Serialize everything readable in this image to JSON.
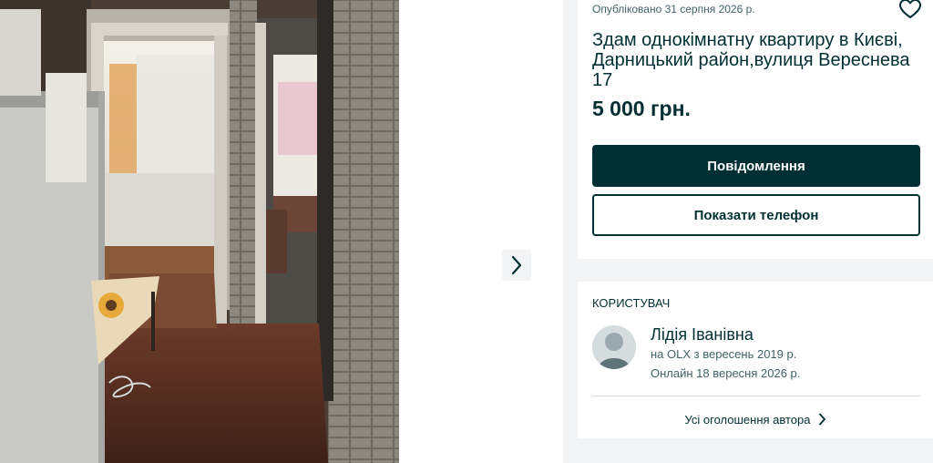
{
  "listing": {
    "published": "Опубліковано 31 серпня 2026 р.",
    "title": "Здам однокімнатну квартиру в Києві, Дарницький район,вулиця Вереснева 17",
    "price": "5 000 грн."
  },
  "actions": {
    "message_label": "Повідомлення",
    "show_phone_label": "Показати телефон"
  },
  "seller": {
    "section_label": "КОРИСТУВАЧ",
    "name": "Лідія Іванівна",
    "member_since": "на OLX з вересень 2019 р.",
    "online": "Онлайн 18 вересня 2026 р.",
    "all_ads_label": "Усі оголошення автора"
  },
  "icons": {
    "favorite": "heart-icon",
    "gallery_next": "chevron-right-icon",
    "all_ads": "chevron-right-icon"
  },
  "colors": {
    "brand_dark": "#002f34",
    "muted_text": "#406367",
    "page_background": "#f2f4f5"
  }
}
